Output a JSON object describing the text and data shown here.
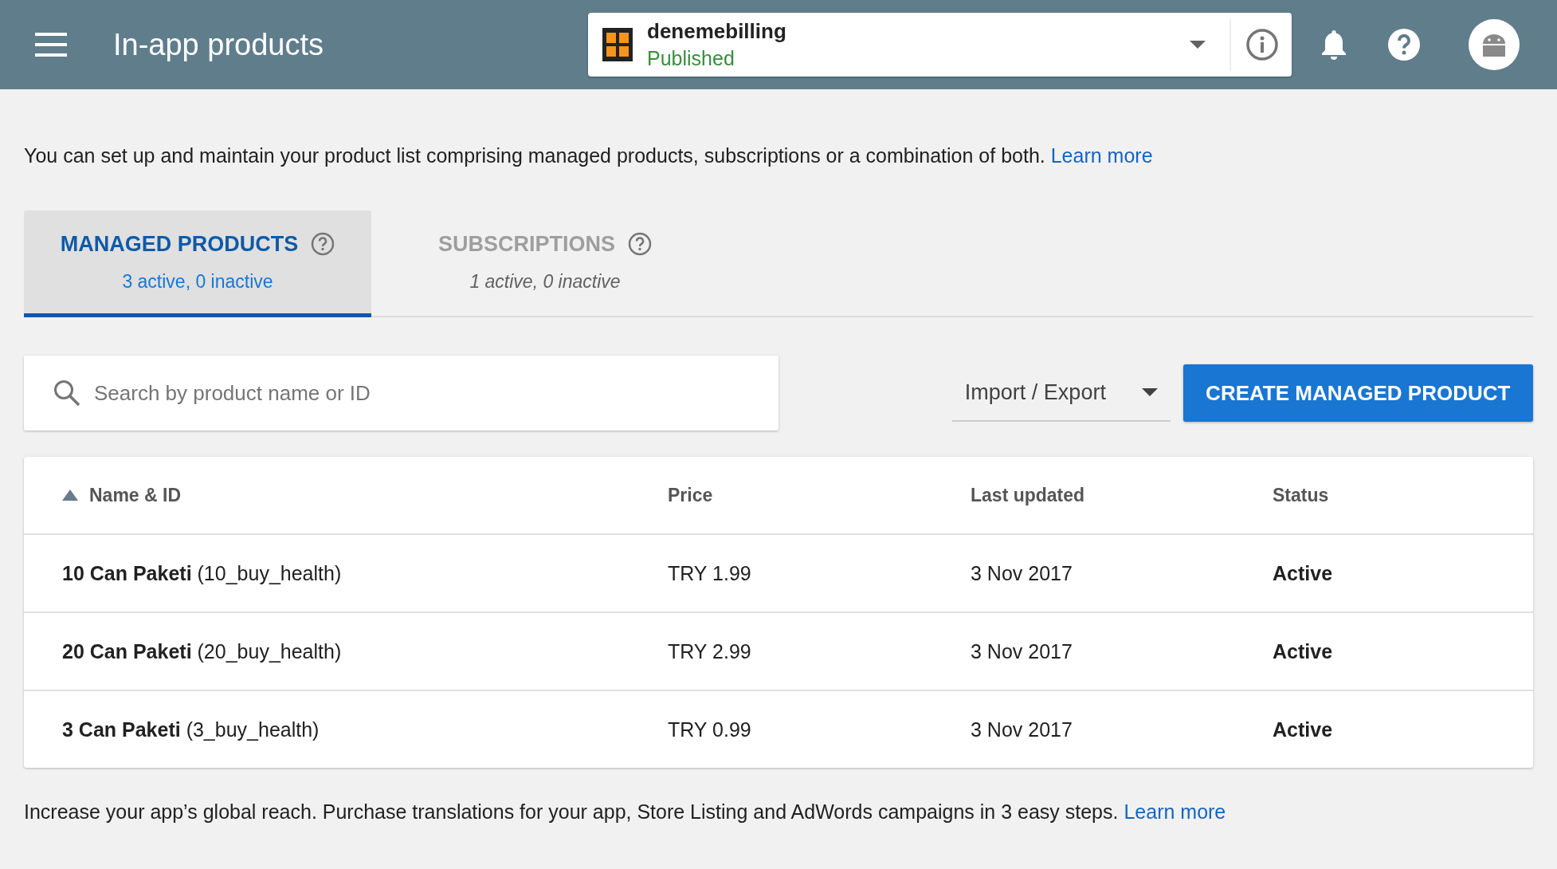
{
  "header": {
    "title": "In-app products",
    "app": {
      "name": "denemebilling",
      "status": "Published"
    }
  },
  "intro": {
    "text": "You can set up and maintain your product list comprising managed products, subscriptions or a combination of both.",
    "link": "Learn more"
  },
  "tabs": [
    {
      "label": "MANAGED PRODUCTS",
      "summary": "3 active, 0 inactive",
      "selected": true
    },
    {
      "label": "SUBSCRIPTIONS",
      "summary": "1 active, 0 inactive",
      "selected": false
    }
  ],
  "search": {
    "placeholder": "Search by product name or ID"
  },
  "import_export": "Import / Export",
  "create_button": "CREATE MANAGED PRODUCT",
  "table": {
    "columns": [
      {
        "label": "Name & ID",
        "sorted": true
      },
      {
        "label": "Price",
        "sorted": false
      },
      {
        "label": "Last updated",
        "sorted": false
      },
      {
        "label": "Status",
        "sorted": false
      }
    ],
    "rows": [
      {
        "name": "**10 Can Paketi** (10_buy_health)",
        "price": "TRY 1.99",
        "updated": "3 Nov 2017",
        "status": "Active"
      },
      {
        "name": "**20 Can Paketi** (20_buy_health)",
        "price": "TRY 2.99",
        "updated": "3 Nov 2017",
        "status": "Active"
      },
      {
        "name": "**3 Can Paketi** (3_buy_health)",
        "price": "TRY 0.99",
        "updated": "3 Nov 2017",
        "status": "Active"
      }
    ]
  },
  "footer": {
    "text": "Increase your app’s global reach. Purchase translations for your app, Store Listing and AdWords campaigns in 3 easy steps.",
    "link": "Learn more"
  }
}
